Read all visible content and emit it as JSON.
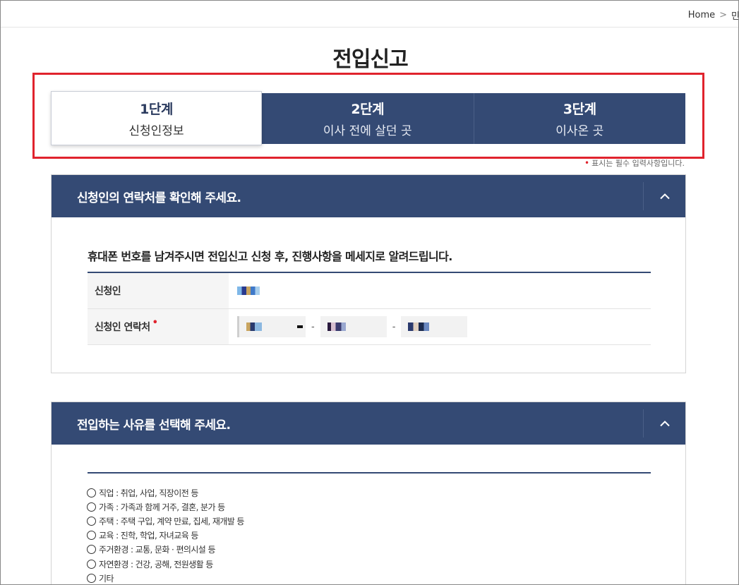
{
  "breadcrumb": {
    "home": "Home",
    "separator": ">",
    "next": "민"
  },
  "page": {
    "title": "전입신고"
  },
  "steps": [
    {
      "num": "1단계",
      "label": "신청인정보",
      "active": true
    },
    {
      "num": "2단계",
      "label": "이사 전에 살던 곳",
      "active": false
    },
    {
      "num": "3단계",
      "label": "이사온 곳",
      "active": false
    }
  ],
  "required_note": {
    "mark": "•",
    "text": "표시는 필수 입력사항입니다."
  },
  "section1": {
    "title": "신청인의 연락처를 확인해 주세요.",
    "intro": "휴대폰 번호를 남겨주시면 전입신고 신청 후, 진행사항을 메세지로 알려드립니다.",
    "rows": [
      {
        "label": "신청인"
      },
      {
        "label": "신청인 연락처",
        "required_mark": "•",
        "dash": "-"
      }
    ]
  },
  "section2": {
    "title": "전입하는 사유를 선택해 주세요.",
    "options": [
      "직업 : 취업, 사업, 직장이전 등",
      "가족 : 가족과 함께 거주, 결혼, 분가 등",
      "주택 : 주택 구입, 계약 만료, 집세, 재개발 등",
      "교육 : 진학, 학업, 자녀교육 등",
      "주거환경 : 교통, 문화 · 편의시설 등",
      "자연환경 : 건강, 공해, 전원생활 등",
      "기타"
    ]
  },
  "colors": {
    "navy": "#344a74",
    "highlight": "#e0232d"
  },
  "icons": {
    "toggle": "chevron-up-icon",
    "radio": "radio-unchecked-icon"
  }
}
